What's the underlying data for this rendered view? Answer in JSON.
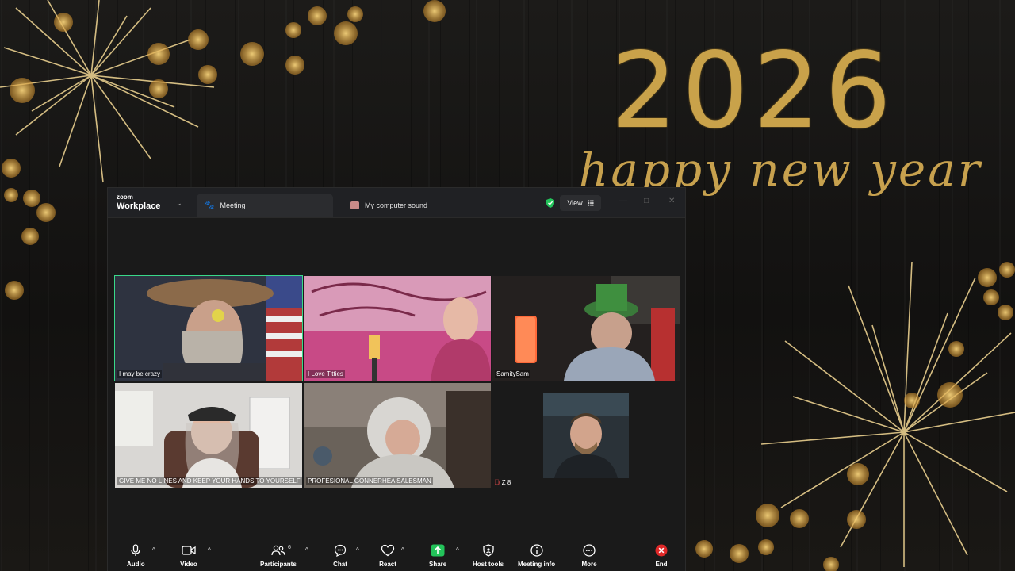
{
  "background": {
    "year": "2026",
    "greeting": "happy new year",
    "accent_gold": "#c9a24a"
  },
  "window": {
    "brand_small": "zoom",
    "brand_large": "Workplace",
    "tabs": [
      {
        "label": "Meeting",
        "icon": "paw-icon"
      },
      {
        "label": "My computer sound",
        "icon": "computer-sound-icon"
      }
    ],
    "view_label": "View",
    "secure_color": "#23c35a"
  },
  "participants_grid": [
    {
      "name": "I may be crazy",
      "active_speaker": true
    },
    {
      "name": "I Love Titties",
      "active_speaker": false
    },
    {
      "name": "SamitySam",
      "active_speaker": false
    },
    {
      "name": "GIVE ME NO LINES AND KEEP YOUR HANDS TO YOURSELF",
      "active_speaker": false
    },
    {
      "name": "PROFESIONAL GONNERHEA SALESMAN",
      "active_speaker": false
    },
    {
      "name": "Z 8",
      "active_speaker": false,
      "muted": true
    }
  ],
  "toolbar": {
    "audio": "Audio",
    "video": "Video",
    "participants": "Participants",
    "participants_count": "6",
    "chat": "Chat",
    "react": "React",
    "share": "Share",
    "host_tools": "Host tools",
    "meeting_info": "Meeting info",
    "more": "More",
    "end": "End",
    "share_color": "#23c35a",
    "end_color": "#e02828"
  }
}
